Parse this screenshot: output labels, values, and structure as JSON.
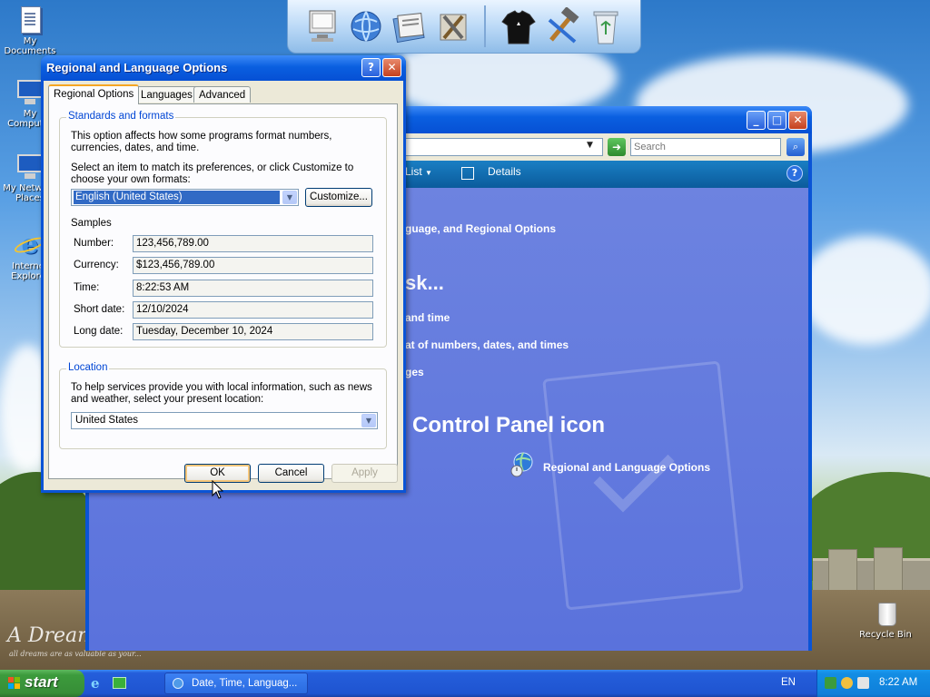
{
  "desktop": {
    "icons": [
      {
        "label": "My Documents"
      },
      {
        "label": "My Computer"
      },
      {
        "label": "My Network Places"
      },
      {
        "label": "Internet Explorer"
      }
    ],
    "recycle_bin_label": "Recycle Bin",
    "wallpaper_caption": "A Dream",
    "wallpaper_subcaption": "all dreams are as valuable as your..."
  },
  "explorer": {
    "search_placeholder": "Search",
    "toolbar": {
      "list_label": "List",
      "details_label": "Details"
    },
    "breadcrumb_fragment": "guage, and Regional Options",
    "task_heading_fragment": "sk...",
    "task_links": [
      "and time",
      "at of numbers, dates, and times",
      "ges"
    ],
    "cp_heading_fragment": "Control Panel icon",
    "cp_item_label": "Regional and Language Options"
  },
  "dialog": {
    "title": "Regional and Language Options",
    "tabs": [
      {
        "label": "Regional Options",
        "active": true
      },
      {
        "label": "Languages",
        "active": false
      },
      {
        "label": "Advanced",
        "active": false
      }
    ],
    "standards": {
      "caption": "Standards and formats",
      "description": "This option affects how some programs format numbers, currencies, dates, and time.",
      "prompt": "Select an item to match its preferences, or click Customize to choose your own formats:",
      "selected_format": "English (United States)",
      "customize_label": "Customize...",
      "samples_label": "Samples",
      "samples": [
        {
          "label": "Number:",
          "value": "123,456,789.00"
        },
        {
          "label": "Currency:",
          "value": "$123,456,789.00"
        },
        {
          "label": "Time:",
          "value": "8:22:53 AM"
        },
        {
          "label": "Short date:",
          "value": "12/10/2024"
        },
        {
          "label": "Long date:",
          "value": "Tuesday, December 10, 2024"
        }
      ]
    },
    "location": {
      "caption": "Location",
      "description": "To help services provide you with local information, such as news and weather, select your present location:",
      "selected": "United States"
    },
    "buttons": {
      "ok": "OK",
      "cancel": "Cancel",
      "apply": "Apply"
    }
  },
  "taskbar": {
    "start_label": "start",
    "task_button_label": "Date, Time, Languag...",
    "language": "EN",
    "clock": "8:22 AM"
  },
  "colors": {
    "title_bar": "#0a5fe0",
    "start_green": "#3c9b3c",
    "dialog_face": "#ece9d8",
    "group_caption": "#0046d5"
  }
}
